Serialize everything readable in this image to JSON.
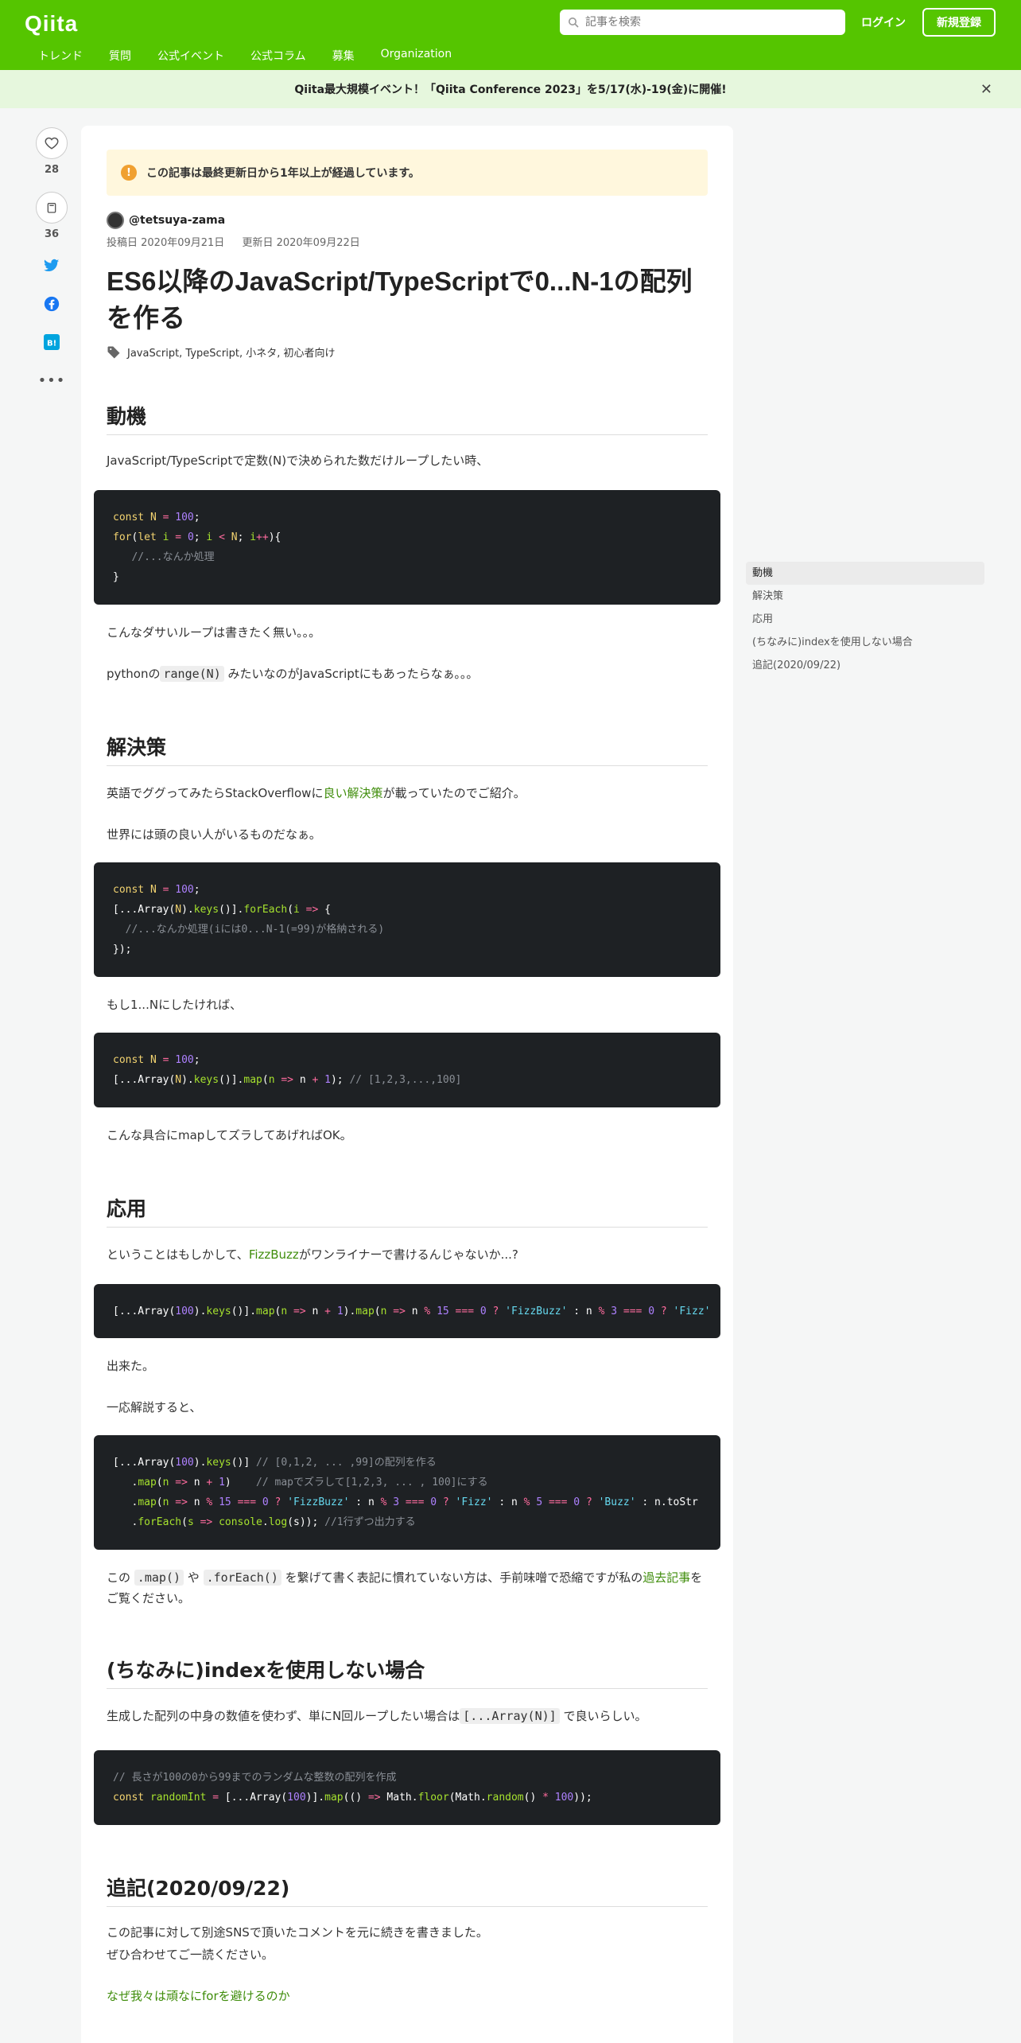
{
  "header": {
    "logo": "Qiita",
    "search_placeholder": "記事を検索",
    "login": "ログイン",
    "signup": "新規登録",
    "nav": [
      "トレンド",
      "質問",
      "公式イベント",
      "公式コラム",
      "募集",
      "Organization"
    ]
  },
  "banner": {
    "text": "Qiita最大規模イベント！「Qiita Conference 2023」を5/17(水)-19(金)に開催!"
  },
  "sidebar": {
    "likes": "28",
    "stocks": "36"
  },
  "article": {
    "notice": "この記事は最終更新日から1年以上が経過しています。",
    "author": "@tetsuya-zama",
    "posted": "投稿日 2020年09月21日",
    "updated": "更新日 2020年09月22日",
    "title": "ES6以降のJavaScript/TypeScriptで0...N-1の配列を作る",
    "tags": "JavaScript, TypeScript, 小ネタ, 初心者向け",
    "h_motive": "動機",
    "p_motive": "JavaScript/TypeScriptで定数(N)で決められた数だけループしたい時、",
    "p_dasai": "こんなダサいループは書きたく無い。。。",
    "p_python_a": "pythonの",
    "p_python_code": "range(N)",
    "p_python_b": "みたいなのがJavaScriptにもあったらなぁ。。。",
    "h_solution": "解決策",
    "p_so_a": "英語でググってみたらStackOverflowに",
    "p_so_link": "良い解決策",
    "p_so_b": "が載っていたのでご紹介。",
    "p_world": "世界には頭の良い人がいるものだなぁ。",
    "p_onetoN": "もし1...Nにしたければ、",
    "p_map": "こんな具合にmapしてズラしてあげればOK。",
    "h_apply": "応用",
    "p_fizz_a": "ということはもしかして、",
    "p_fizz_link": "FizzBuzz",
    "p_fizz_b": "がワンライナーで書けるんじゃないか...?",
    "p_done": "出来た。",
    "p_explain": "一応解説すると、",
    "p_chain_a": "この",
    "p_chain_c1": ".map()",
    "p_chain_m": "や",
    "p_chain_c2": ".forEach()",
    "p_chain_b": "を繋げて書く表記に慣れていない方は、手前味噌で恐縮ですが私の",
    "p_chain_link": "過去記事",
    "p_chain_end": "をご覧ください。",
    "h_noindex": "(ちなみに)indexを使用しない場合",
    "p_noindex_a": "生成した配列の中身の数値を使わず、単にN回ループしたい場合は",
    "p_noindex_code": "[...Array(N)]",
    "p_noindex_b": "で良いらしい。",
    "h_postscript": "追記(2020/09/22)",
    "p_ps1": "この記事に対して別途SNSで頂いたコメントを元に続きを書きました。",
    "p_ps2": "ぜひ合わせてご一読ください。",
    "p_ps_link": "なぜ我々は頑なにforを避けるのか"
  },
  "toc": [
    "動機",
    "解決策",
    "応用",
    "(ちなみに)indexを使用しない場合",
    "追記(2020/09/22)"
  ],
  "colors": {
    "brand": "#55c500",
    "banner_bg": "#e6f7dd",
    "code_bg": "#1e2124",
    "link": "#3f8d0b"
  }
}
